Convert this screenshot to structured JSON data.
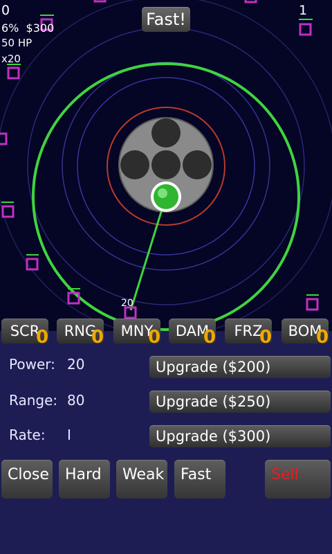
{
  "hud": {
    "score": "0",
    "percent_money": "6%  $300",
    "hp": "50 HP",
    "multiplier": "x20",
    "wave": "1",
    "fast_button": "Fast!"
  },
  "tower": {
    "level_label": "20"
  },
  "tabs": [
    {
      "label": "SCR",
      "count": "0"
    },
    {
      "label": "RNG",
      "count": "0"
    },
    {
      "label": "MNY",
      "count": "0"
    },
    {
      "label": "DAM",
      "count": "0"
    },
    {
      "label": "FRZ",
      "count": "0"
    },
    {
      "label": "BOM",
      "count": "0"
    }
  ],
  "stats": {
    "power": {
      "label": "Power:",
      "value": "20",
      "button": "Upgrade ($200)"
    },
    "range": {
      "label": "Range:",
      "value": "80",
      "button": "Upgrade ($250)"
    },
    "rate": {
      "label": "Rate:",
      "value": "I",
      "button": "Upgrade ($300)"
    }
  },
  "actions": {
    "close": "Close",
    "hard": "Hard",
    "weak": "Weak",
    "fast": "Fast",
    "sell": "Sell"
  },
  "colors": {
    "background": "#050525",
    "panel": "#1d1d54",
    "range_ring": "#3fd43f",
    "enemy": "#c030c0",
    "count": "#f0a800",
    "sell": "#e02020"
  }
}
